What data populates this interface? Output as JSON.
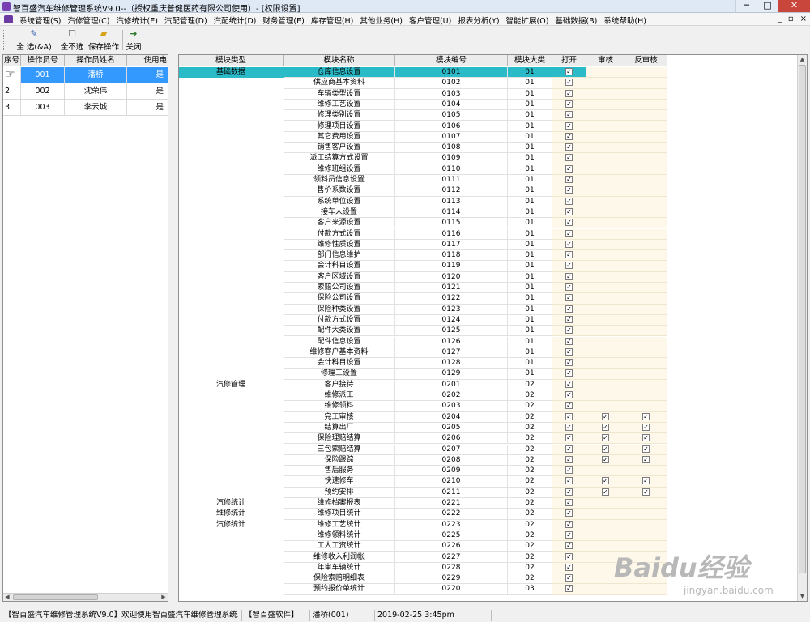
{
  "window": {
    "title": "智百盛汽车维修管理系统V9.0--（授权重庆普健医药有限公司使用）- [权限设置]",
    "minimize": "─",
    "restore": "□",
    "close": "✕",
    "mdi_minimize": "_",
    "mdi_restore": "▫",
    "mdi_close": "×"
  },
  "menu": [
    "系统管理(S)",
    "汽修管理(C)",
    "汽修统计(E)",
    "汽配管理(D)",
    "汽配统计(D)",
    "财务管理(E)",
    "库存管理(H)",
    "其他业务(H)",
    "客户管理(U)",
    "报表分析(Y)",
    "智能扩展(O)",
    "基础数据(B)",
    "系统帮助(H)"
  ],
  "toolbar": {
    "select_all": "全 选(&A)",
    "select_none": "全不选",
    "save": "保存操作",
    "close": "关闭"
  },
  "operators": {
    "headers": [
      "序号",
      "操作员号",
      "操作员姓名",
      "使用电"
    ],
    "rows": [
      {
        "seq": "1",
        "id": "001",
        "name": "潘桥",
        "use": "是"
      },
      {
        "seq": "2",
        "id": "002",
        "name": "沈荣伟",
        "use": "是"
      },
      {
        "seq": "3",
        "id": "003",
        "name": "李云城",
        "use": "是"
      }
    ]
  },
  "modules": {
    "headers": [
      "模块类型",
      "模块名称",
      "模块编号",
      "模块大类",
      "打开",
      "审核",
      "反审核"
    ],
    "rows": [
      {
        "type": "基础数据",
        "name": "仓库信息设置",
        "code": "0101",
        "cat": "01",
        "open": true
      },
      {
        "type": "",
        "name": "供应商基本资料",
        "code": "0102",
        "cat": "01",
        "open": true
      },
      {
        "type": "",
        "name": "车辆类型设置",
        "code": "0103",
        "cat": "01",
        "open": true
      },
      {
        "type": "",
        "name": "维修工艺设置",
        "code": "0104",
        "cat": "01",
        "open": true
      },
      {
        "type": "",
        "name": "修理类别设置",
        "code": "0105",
        "cat": "01",
        "open": true
      },
      {
        "type": "",
        "name": "修理项目设置",
        "code": "0106",
        "cat": "01",
        "open": true
      },
      {
        "type": "",
        "name": "其它费用设置",
        "code": "0107",
        "cat": "01",
        "open": true
      },
      {
        "type": "",
        "name": "销售客户设置",
        "code": "0108",
        "cat": "01",
        "open": true
      },
      {
        "type": "",
        "name": "派工结算方式设置",
        "code": "0109",
        "cat": "01",
        "open": true
      },
      {
        "type": "",
        "name": "维修班组设置",
        "code": "0110",
        "cat": "01",
        "open": true
      },
      {
        "type": "",
        "name": "领料员信息设置",
        "code": "0111",
        "cat": "01",
        "open": true
      },
      {
        "type": "",
        "name": "售价系数设置",
        "code": "0112",
        "cat": "01",
        "open": true
      },
      {
        "type": "",
        "name": "系统单位设置",
        "code": "0113",
        "cat": "01",
        "open": true
      },
      {
        "type": "",
        "name": "接车人设置",
        "code": "0114",
        "cat": "01",
        "open": true
      },
      {
        "type": "",
        "name": "客户来源设置",
        "code": "0115",
        "cat": "01",
        "open": true
      },
      {
        "type": "",
        "name": "付款方式设置",
        "code": "0116",
        "cat": "01",
        "open": true
      },
      {
        "type": "",
        "name": "维修性质设置",
        "code": "0117",
        "cat": "01",
        "open": true
      },
      {
        "type": "",
        "name": "部门信息维护",
        "code": "0118",
        "cat": "01",
        "open": true
      },
      {
        "type": "",
        "name": "会计科目设置",
        "code": "0119",
        "cat": "01",
        "open": true
      },
      {
        "type": "",
        "name": "客户区域设置",
        "code": "0120",
        "cat": "01",
        "open": true
      },
      {
        "type": "",
        "name": "索赔公司设置",
        "code": "0121",
        "cat": "01",
        "open": true
      },
      {
        "type": "",
        "name": "保险公司设置",
        "code": "0122",
        "cat": "01",
        "open": true
      },
      {
        "type": "",
        "name": "保险种类设置",
        "code": "0123",
        "cat": "01",
        "open": true
      },
      {
        "type": "",
        "name": "付款方式设置",
        "code": "0124",
        "cat": "01",
        "open": true
      },
      {
        "type": "",
        "name": "配件大类设置",
        "code": "0125",
        "cat": "01",
        "open": true
      },
      {
        "type": "",
        "name": "配件信息设置",
        "code": "0126",
        "cat": "01",
        "open": true
      },
      {
        "type": "",
        "name": "维修客户基本资料",
        "code": "0127",
        "cat": "01",
        "open": true
      },
      {
        "type": "",
        "name": "会计科目设置",
        "code": "0128",
        "cat": "01",
        "open": true
      },
      {
        "type": "",
        "name": "修理工设置",
        "code": "0129",
        "cat": "01",
        "open": true
      },
      {
        "type": "汽修管理",
        "name": "客户接待",
        "code": "0201",
        "cat": "02",
        "open": true
      },
      {
        "type": "",
        "name": "维修派工",
        "code": "0202",
        "cat": "02",
        "open": true
      },
      {
        "type": "",
        "name": "维修领料",
        "code": "0203",
        "cat": "02",
        "open": true
      },
      {
        "type": "",
        "name": "完工审核",
        "code": "0204",
        "cat": "02",
        "open": true,
        "audit": true,
        "unaudit": true
      },
      {
        "type": "",
        "name": "结算出厂",
        "code": "0205",
        "cat": "02",
        "open": true,
        "audit": true,
        "unaudit": true
      },
      {
        "type": "",
        "name": "保险理赔结算",
        "code": "0206",
        "cat": "02",
        "open": true,
        "audit": true,
        "unaudit": true
      },
      {
        "type": "",
        "name": "三包索赔结算",
        "code": "0207",
        "cat": "02",
        "open": true,
        "audit": true,
        "unaudit": true
      },
      {
        "type": "",
        "name": "保险跟踪",
        "code": "0208",
        "cat": "02",
        "open": true,
        "audit": true,
        "unaudit": true
      },
      {
        "type": "",
        "name": "售后服务",
        "code": "0209",
        "cat": "02",
        "open": true
      },
      {
        "type": "",
        "name": "快速修车",
        "code": "0210",
        "cat": "02",
        "open": true,
        "audit": true,
        "unaudit": true
      },
      {
        "type": "",
        "name": "预约安排",
        "code": "0211",
        "cat": "02",
        "open": true,
        "audit": true,
        "unaudit": true
      },
      {
        "type": "汽修统计",
        "name": "维修档案报表",
        "code": "0221",
        "cat": "02",
        "open": true
      },
      {
        "type": "维修统计",
        "name": "维修项目统计",
        "code": "0222",
        "cat": "02",
        "open": true
      },
      {
        "type": "汽修统计",
        "name": "维修工艺统计",
        "code": "0223",
        "cat": "02",
        "open": true
      },
      {
        "type": "",
        "name": "维修领料统计",
        "code": "0225",
        "cat": "02",
        "open": true
      },
      {
        "type": "",
        "name": "工人工资统计",
        "code": "0226",
        "cat": "02",
        "open": true
      },
      {
        "type": "",
        "name": "维修收入利润帐",
        "code": "0227",
        "cat": "02",
        "open": true
      },
      {
        "type": "",
        "name": "年审车辆统计",
        "code": "0228",
        "cat": "02",
        "open": true
      },
      {
        "type": "",
        "name": "保险索赔明细表",
        "code": "0229",
        "cat": "02",
        "open": true
      },
      {
        "type": "",
        "name": "预约报价单统计",
        "code": "0220",
        "cat": "03",
        "open": true
      }
    ]
  },
  "status": {
    "app": "【智百盛汽车维修管理系统V9.0】欢迎使用智百盛汽车维修管理系统...",
    "vendor": "【智百盛软件】",
    "user": "潘桥(001)",
    "datetime": "2019-02-25 3:45pm"
  },
  "watermark": {
    "brand": "Baidu经验",
    "url": "jingyan.baidu.com"
  }
}
